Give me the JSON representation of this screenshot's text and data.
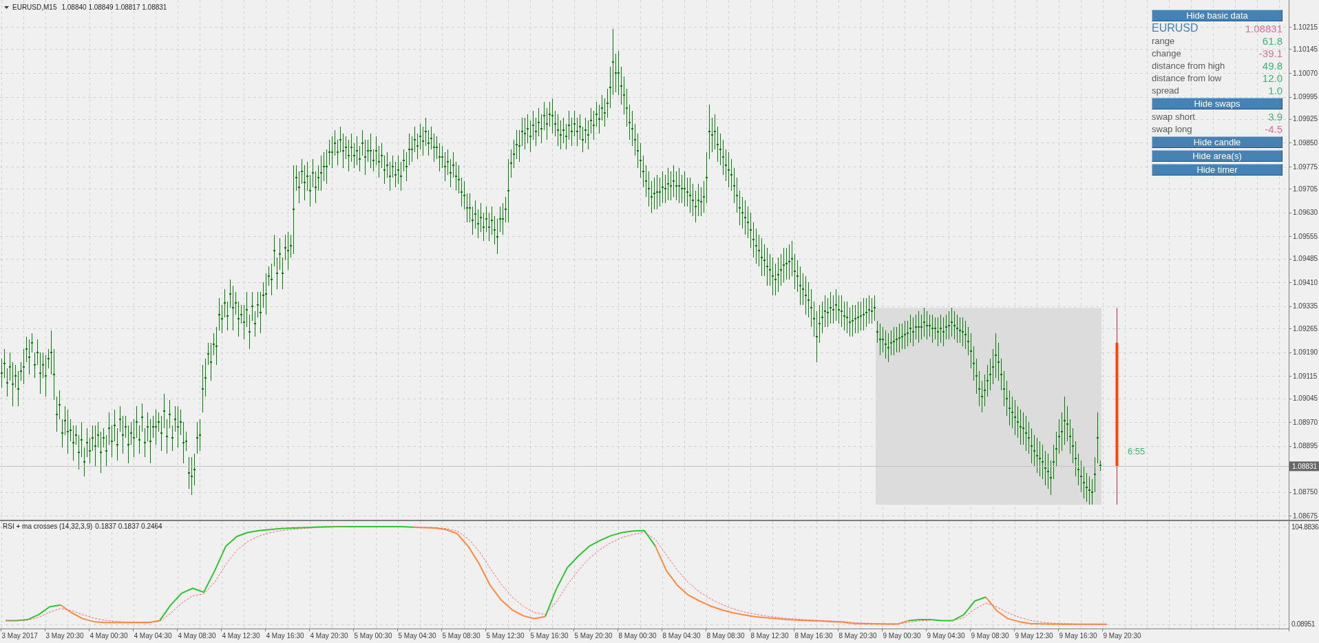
{
  "price_panel": {
    "header": {
      "symbol": "EURUSD,M15",
      "quotes": "1.08840 1.08849 1.08817 1.08831"
    },
    "chart_data": {
      "type": "scatter",
      "grid": true,
      "ylim": [
        1.08669,
        1.103
      ],
      "yticks": [
        {
          "value": 1.10215,
          "label": "1.10215"
        },
        {
          "value": 1.10145,
          "label": "1.10145"
        },
        {
          "value": 1.1007,
          "label": "1.10070"
        },
        {
          "value": 1.09995,
          "label": "1.09995"
        },
        {
          "value": 1.09925,
          "label": "1.09925"
        },
        {
          "value": 1.0985,
          "label": "1.09850"
        },
        {
          "value": 1.09775,
          "label": "1.09775"
        },
        {
          "value": 1.09705,
          "label": "1.09705"
        },
        {
          "value": 1.0963,
          "label": "1.09630"
        },
        {
          "value": 1.09555,
          "label": "1.09555"
        },
        {
          "value": 1.09485,
          "label": "1.09485"
        },
        {
          "value": 1.0941,
          "label": "1.09410"
        },
        {
          "value": 1.09335,
          "label": "1.09335"
        },
        {
          "value": 1.09265,
          "label": "1.09265"
        },
        {
          "value": 1.0919,
          "label": "1.09190"
        },
        {
          "value": 1.09115,
          "label": "1.09115"
        },
        {
          "value": 1.09045,
          "label": "1.09045"
        },
        {
          "value": 1.0897,
          "label": "1.08970"
        },
        {
          "value": 1.08895,
          "label": "1.08895"
        },
        {
          "value": 1.0875,
          "label": "1.08750"
        },
        {
          "value": 1.08675,
          "label": "1.08675"
        }
      ],
      "series": [
        {
          "color": "#007f00",
          "values": [
            1.09125,
            1.09155,
            1.09095,
            1.09145,
            1.0909,
            1.09115,
            1.09075,
            1.0913,
            1.09145,
            1.092,
            1.09175,
            1.0922,
            1.0915,
            1.0919,
            1.09125,
            1.0915,
            1.09115,
            1.0917,
            1.0919,
            1.0912,
            1.08995,
            1.09025,
            1.08935,
            1.08975,
            1.0894,
            1.08945,
            1.08905,
            1.0893,
            1.08875,
            1.08915,
            1.08845,
            1.08905,
            1.0888,
            1.0892,
            1.08895,
            1.0893,
            1.08875,
            1.0892,
            1.0888,
            1.0895,
            1.0891,
            1.0896,
            1.089,
            1.0898,
            1.0893,
            1.08955,
            1.089,
            1.08935,
            1.0892,
            1.0897,
            1.08915,
            1.08985,
            1.08905,
            1.08955,
            1.0891,
            1.08955,
            1.08955,
            1.0897,
            1.08935,
            1.09005,
            1.08925,
            1.08995,
            1.0892,
            1.0898,
            1.08955,
            1.0897,
            1.08905,
            1.0891,
            1.0881,
            1.088,
            1.0882,
            1.0892,
            1.0893,
            1.09075,
            1.0911,
            1.09185,
            1.0916,
            1.09215,
            1.0921,
            1.0931,
            1.09295,
            1.09345,
            1.09305,
            1.09375,
            1.0933,
            1.09345,
            1.09295,
            1.0931,
            1.09285,
            1.09325,
            1.09255,
            1.09335,
            1.0928,
            1.0934,
            1.09315,
            1.0937,
            1.09375,
            1.0943,
            1.0942,
            1.0951,
            1.0944,
            1.095,
            1.0944,
            1.0952,
            1.0951,
            1.09525,
            1.0964,
            1.0974,
            1.0971,
            1.0976,
            1.09725,
            1.09745,
            1.097,
            1.09755,
            1.0971,
            1.0974,
            1.09755,
            1.09775,
            1.09775,
            1.0982,
            1.0982,
            1.0985,
            1.0982,
            1.0986,
            1.09825,
            1.09835,
            1.0981,
            1.09835,
            1.0981,
            1.09825,
            1.098,
            1.0985,
            1.09805,
            1.09825,
            1.09825,
            1.09795,
            1.09825,
            1.0979,
            1.0981,
            1.09765,
            1.0978,
            1.09745,
            1.09775,
            1.0975,
            1.09765,
            1.09745,
            1.09795,
            1.09775,
            1.0983,
            1.0983,
            1.0986,
            1.0984,
            1.0987,
            1.09855,
            1.09885,
            1.0985,
            1.09865,
            1.09835,
            1.09835,
            1.09805,
            1.09805,
            1.09775,
            1.0979,
            1.09755,
            1.0978,
            1.09745,
            1.09735,
            1.09695,
            1.09685,
            1.09645,
            1.09645,
            1.09605,
            1.09625,
            1.09595,
            1.09615,
            1.09585,
            1.0961,
            1.09585,
            1.09605,
            1.09575,
            1.09555,
            1.0961,
            1.0961,
            1.0964,
            1.097,
            1.09785,
            1.09815,
            1.09845,
            1.0984,
            1.09885,
            1.0988,
            1.09895,
            1.0987,
            1.09905,
            1.09885,
            1.09915,
            1.09895,
            1.09935,
            1.0991,
            1.0994,
            1.09935,
            1.0991,
            1.0989,
            1.09875,
            1.0989,
            1.0987,
            1.09905,
            1.09885,
            1.0991,
            1.09885,
            1.099,
            1.0986,
            1.0989,
            1.09875,
            1.0992,
            1.09905,
            1.0994,
            1.09925,
            1.0996,
            1.09945,
            1.09975,
            1.10025,
            1.10105,
            1.1007,
            1.1007,
            1.1003,
            1.1,
            1.0996,
            1.09915,
            1.09895,
            1.0986,
            1.09825,
            1.09795,
            1.0976,
            1.0973,
            1.09705,
            1.0968,
            1.0969,
            1.09695,
            1.09695,
            1.0971,
            1.09705,
            1.0972,
            1.09715,
            1.0973,
            1.09715,
            1.09715,
            1.09705,
            1.09705,
            1.09695,
            1.09685,
            1.0967,
            1.0965,
            1.0967,
            1.09665,
            1.0968,
            1.0974,
            1.09885,
            1.09875,
            1.09885,
            1.09845,
            1.0983,
            1.09805,
            1.0978,
            1.09765,
            1.0975,
            1.09715,
            1.09685,
            1.09645,
            1.0963,
            1.09615,
            1.096,
            1.09575,
            1.09545,
            1.09525,
            1.0951,
            1.0949,
            1.0948,
            1.0946,
            1.0945,
            1.0943,
            1.0942,
            1.09435,
            1.0945,
            1.09465,
            1.0947,
            1.09475,
            1.09485,
            1.09445,
            1.0943,
            1.094,
            1.0939,
            1.0937,
            1.09355,
            1.0933,
            1.09295,
            1.0924,
            1.0928,
            1.093,
            1.0932,
            1.09315,
            1.0933,
            1.09325,
            1.0934,
            1.09325,
            1.0932,
            1.09305,
            1.093,
            1.09285,
            1.0929,
            1.09295,
            1.093,
            1.09305,
            1.0931,
            1.09315,
            1.09325,
            1.0932,
            1.0933,
            1.09255,
            1.0923,
            1.0923,
            1.09215,
            1.09205,
            1.0922,
            1.09225,
            1.0923,
            1.09235,
            1.0924,
            1.09245,
            1.0925,
            1.09265,
            1.09255,
            1.0927,
            1.0927,
            1.0927,
            1.09285,
            1.09275,
            1.09275,
            1.09265,
            1.09265,
            1.09255,
            1.09265,
            1.09255,
            1.0927,
            1.09275,
            1.09285,
            1.09275,
            1.09265,
            1.0926,
            1.09255,
            1.09245,
            1.09225,
            1.09195,
            1.09155,
            1.09115,
            1.09075,
            1.0905,
            1.0907,
            1.091,
            1.0912,
            1.09145,
            1.0918,
            1.0916,
            1.0912,
            1.09075,
            1.09045,
            1.09015,
            1.09,
            1.08985,
            1.0897,
            1.08955,
            1.0895,
            1.08935,
            1.0892,
            1.08895,
            1.0888,
            1.08865,
            1.08855,
            1.08845,
            1.08825,
            1.08815,
            1.08795,
            1.08845,
            1.08885,
            1.08925,
            1.0894,
            1.08975,
            1.08965,
            1.08925,
            1.08895,
            1.08855,
            1.0882,
            1.088,
            1.0878,
            1.08765,
            1.08755,
            1.0875,
            1.08805,
            1.0892,
            1.08833,
            null,
            null,
            null,
            null,
            null,
            null,
            null,
            null,
            null,
            null,
            null,
            null,
            null,
            null,
            null,
            null,
            null,
            null,
            null,
            null,
            null,
            null,
            null,
            null,
            null,
            null,
            null,
            null,
            null,
            null,
            null,
            null,
            null,
            null,
            null,
            null,
            null,
            null,
            null,
            null,
            null,
            null,
            null,
            null,
            null,
            null,
            null,
            null,
            null,
            null,
            null,
            null,
            null,
            null,
            null,
            null,
            null,
            null,
            null,
            null,
            null,
            null,
            null,
            null,
            null,
            null,
            null,
            null
          ],
          "errors": [
            0.00045,
            0.00045,
            0.00045,
            0.00045,
            0.0007,
            0.00035,
            0.00055,
            0.0003,
            0.00055,
            0.0004,
            0.00055,
            0.0003,
            0.0004,
            0.0004,
            0.00065,
            0.0004,
            0.00065,
            0.0003,
            0.0007,
            0.0008,
            0.00055,
            0.00045,
            0.00045,
            0.00045,
            0.0007,
            0.00035,
            0.00055,
            0.0003,
            0.00055,
            0.00055,
            0.00045,
            0.00045,
            0.0004,
            0.0004,
            0.00065,
            0.0004,
            0.00065,
            0.0003,
            0.0005,
            0.0005,
            0.0005,
            0.0005,
            0.0005,
            0.0004,
            0.0006,
            0.00035,
            0.0006,
            0.00035,
            0.0006,
            0.0005,
            0.00045,
            0.00045,
            0.00045,
            0.00045,
            0.0007,
            0.00035,
            0.00055,
            0.0003,
            0.00055,
            0.00055,
            0.00055,
            0.00045,
            0.0004,
            0.0004,
            0.00065,
            0.0004,
            0.00065,
            0.0003,
            0.0005,
            0.0006,
            0.0005,
            0.0005,
            0.0005,
            0.00075,
            0.0006,
            0.00035,
            0.0006,
            0.00035,
            0.0006,
            0.0005,
            0.00045,
            0.00045,
            0.00045,
            0.00045,
            0.0007,
            0.00035,
            0.00055,
            0.0003,
            0.00055,
            0.00055,
            0.00055,
            0.00045,
            0.0004,
            0.0004,
            0.00065,
            0.0004,
            0.00065,
            0.0003,
            0.0005,
            0.0005,
            0.0005,
            0.0005,
            0.0005,
            0.0004,
            0.0006,
            0.00035,
            0.0014,
            0.0004,
            0.0005,
            0.0004,
            0.00055,
            0.00045,
            0.0005,
            0.00045,
            0.0005,
            0.0004,
            0.00055,
            0.00045,
            0.00055,
            0.0004,
            0.0005,
            0.0004,
            0.0004,
            0.0004,
            0.00055,
            0.00035,
            0.0005,
            0.00045,
            0.0004,
            0.00045,
            0.0004,
            0.0004,
            0.00055,
            0.00035,
            0.00055,
            0.00035,
            0.00045,
            0.0005,
            0.0004,
            0.00045,
            0.0004,
            0.00045,
            0.00035,
            0.0004,
            0.00045,
            0.00045,
            0.00035,
            0.00045,
            0.0005,
            0.0004,
            0.0004,
            0.0004,
            0.0004,
            0.00045,
            0.00045,
            0.0004,
            0.00035,
            0.00045,
            0.00035,
            0.00045,
            0.00035,
            0.00045,
            0.0004,
            0.00045,
            0.0004,
            0.00045,
            0.00045,
            0.00045,
            0.00045,
            0.00045,
            0.00045,
            0.00045,
            0.00045,
            0.00045,
            0.00045,
            0.00045,
            0.0004,
            0.00045,
            0.00045,
            0.00045,
            0.00055,
            0.0004,
            0.0005,
            0.0004,
            0.001,
            0.00045,
            0.00045,
            0.00045,
            0.0005,
            0.00045,
            0.0005,
            0.00045,
            0.0005,
            0.00045,
            0.00045,
            0.00045,
            0.00045,
            0.00045,
            0.0005,
            0.0004,
            0.00055,
            0.0004,
            0.0005,
            0.00045,
            0.0004,
            0.0004,
            0.00045,
            0.00045,
            0.0004,
            0.00045,
            0.0004,
            0.0004,
            0.0004,
            0.00045,
            0.0004,
            0.00045,
            0.0004,
            0.00045,
            0.0004,
            0.00045,
            0.00045,
            0.00065,
            0.00105,
            0.0006,
            0.0007,
            0.0006,
            0.0006,
            0.0006,
            0.00055,
            0.00055,
            0.0005,
            0.00055,
            0.00055,
            0.0005,
            0.0005,
            0.00055,
            0.0005,
            0.0005,
            0.00055,
            0.00045,
            0.0005,
            0.00045,
            0.0005,
            0.00045,
            0.0005,
            0.00045,
            0.00055,
            0.00045,
            0.00055,
            0.00045,
            0.00055,
            0.0005,
            0.0005,
            0.0005,
            0.00045,
            0.0005,
            0.0008,
            0.00085,
            0.00055,
            0.00055,
            0.00055,
            0.0005,
            0.00055,
            0.0005,
            0.00055,
            0.0005,
            0.00055,
            0.00055,
            0.00055,
            0.0005,
            0.00055,
            0.0005,
            0.00055,
            0.00055,
            0.00055,
            0.0005,
            0.0006,
            0.0005,
            0.0006,
            0.0005,
            0.0006,
            0.0005,
            0.00055,
            0.0005,
            0.00055,
            0.0005,
            0.00055,
            0.00055,
            0.00055,
            0.0005,
            0.0006,
            0.0005,
            0.0006,
            0.00055,
            0.0006,
            0.00055,
            0.0008,
            0.0006,
            0.0005,
            0.0005,
            0.00045,
            0.0005,
            0.00045,
            0.0005,
            0.00045,
            0.0005,
            0.00045,
            0.0005,
            0.00045,
            0.0005,
            0.00045,
            0.0005,
            0.00045,
            0.0005,
            0.00045,
            0.00045,
            0.0004,
            0.0004,
            0.00035,
            0.0005,
            0.0004,
            0.00045,
            0.00045,
            0.0004,
            0.00045,
            0.0004,
            0.00045,
            0.0004,
            0.00045,
            0.0004,
            0.00045,
            0.00045,
            0.0004,
            0.0005,
            0.0004,
            0.00045,
            0.00045,
            0.00035,
            0.00045,
            0.00035,
            0.00045,
            0.00045,
            0.00045,
            0.0004,
            0.00045,
            0.00045,
            0.00045,
            0.00045,
            0.0004,
            0.00045,
            0.00045,
            0.00045,
            0.00055,
            0.00055,
            0.00055,
            0.00055,
            0.0005,
            0.0005,
            0.0005,
            0.0005,
            0.00055,
            0.0007,
            0.0006,
            0.0005,
            0.00055,
            0.00055,
            0.00055,
            0.0005,
            0.00055,
            0.0005,
            0.00055,
            0.0005,
            0.00055,
            0.0005,
            0.00055,
            0.0005,
            0.00055,
            0.00055,
            0.00055,
            0.00055,
            0.00055,
            0.00055,
            0.00055,
            0.00055,
            0.00055,
            0.0006,
            0.00075,
            0.00055,
            0.00055,
            0.00055,
            0.00055,
            0.0005,
            0.0005,
            0.0005,
            0.00045,
            0.00045,
            0.0004,
            0.00055,
            0.0008,
            0.00016,
            null,
            null,
            null,
            null,
            null,
            null,
            null,
            null,
            null,
            null,
            null,
            null,
            null,
            null,
            null,
            null,
            null,
            null,
            null,
            null,
            null,
            null,
            null,
            null,
            null,
            null,
            null,
            null,
            null,
            null,
            null,
            null,
            null,
            null,
            null,
            null,
            null,
            null,
            null,
            null,
            null,
            null,
            null,
            null,
            null,
            null,
            null,
            null,
            null,
            null,
            null,
            null,
            null,
            null,
            null,
            null,
            null,
            null,
            null,
            null,
            null,
            null,
            null,
            null,
            null,
            null,
            null,
            null
          ]
        }
      ],
      "ref_lines": [
        {
          "axis": "y",
          "value": 1.08831,
          "label": "1.08831"
        }
      ],
      "annotations": [
        "6:55"
      ]
    }
  },
  "info_panel": {
    "items": [
      {
        "kind": "button",
        "label": "Hide basic data"
      },
      {
        "kind": "symbol",
        "label": "EURUSD",
        "value": "1.08831",
        "color": "#db7093"
      },
      {
        "kind": "row",
        "label": "range",
        "value": "61.8",
        "color": "#3cb371"
      },
      {
        "kind": "row",
        "label": "change",
        "value": "-39.1",
        "color": "#db7093"
      },
      {
        "kind": "row",
        "label": "distance from high",
        "value": "49.8",
        "color": "#3cb371"
      },
      {
        "kind": "row",
        "label": "distance from low",
        "value": "12.0",
        "color": "#3cb371"
      },
      {
        "kind": "row",
        "label": "spread",
        "value": "1.0",
        "color": "#3cb371"
      },
      {
        "kind": "button",
        "label": "Hide swaps"
      },
      {
        "kind": "row",
        "label": "swap short",
        "value": "3.9",
        "color": "#3cb371"
      },
      {
        "kind": "row",
        "label": "swap long",
        "value": "-4.5",
        "color": "#db7093"
      },
      {
        "kind": "button",
        "label": "Hide candle"
      },
      {
        "kind": "button",
        "label": "Hide area(s)"
      },
      {
        "kind": "button",
        "label": "Hide timer"
      }
    ]
  },
  "indicator_panel": {
    "header": {
      "name": "RSI + ma crosses (14,32,3,9)",
      "values": "0.1837 0.1837 0.2464"
    },
    "chart_data": {
      "type": "line",
      "grid": true,
      "ylim": [
        -4.34,
        110.79
      ],
      "categories": [
        null,
        "3 May 2017",
        null,
        null,
        null,
        "3 May 20:30",
        null,
        null,
        null,
        "4 May 00:30",
        null,
        null,
        null,
        "4 May 04:30",
        null,
        null,
        null,
        "4 May 08:30",
        null,
        null,
        null,
        "4 May 12:30",
        null,
        null,
        null,
        "4 May 16:30",
        null,
        null,
        null,
        "4 May 20:30",
        null,
        null,
        null,
        "5 May 00:30",
        null,
        null,
        null,
        "5 May 04:30",
        null,
        null,
        null,
        "5 May 08:30",
        null,
        null,
        null,
        "5 May 12:30",
        null,
        null,
        null,
        "5 May 16:30",
        null,
        null,
        null,
        "5 May 20:30",
        null,
        null,
        null,
        "8 May 00:30",
        null,
        null,
        null,
        "8 May 04:30",
        null,
        null,
        null,
        "8 May 08:30",
        null,
        null,
        null,
        "8 May 12:30",
        null,
        null,
        null,
        "8 May 16:30",
        null,
        null,
        null,
        "8 May 20:30",
        null,
        null,
        null,
        "9 May 00:30",
        null,
        null,
        null,
        "9 May 04:30",
        null,
        null,
        null,
        "9 May 08:30",
        null,
        null,
        null,
        "9 May 12:30",
        null,
        null,
        null,
        "9 May 16:30",
        null,
        null,
        null,
        "9 May 20:30",
        null,
        null,
        null,
        null,
        null,
        null,
        null,
        null,
        null,
        null,
        null,
        null,
        null,
        null,
        null
      ],
      "yticks": [
        {
          "value": 104.8836,
          "label": "104.8836"
        },
        {
          "value": 0.08951,
          "label": "0.08951"
        }
      ],
      "series": [
        {
          "color": "#2fc52f",
          "values": [
            4.2,
            4.2,
            5.2,
            10.5,
            18.9,
            21,
            null,
            null,
            null,
            null,
            null,
            null,
            null,
            null,
            4.2,
            21,
            33.6,
            38.8,
            34.6,
            57.7,
            83.9,
            94.4,
            98.6,
            100.7,
            101.7,
            102.8,
            103.3,
            103.8,
            104.4,
            104.7,
            104.9,
            104.9,
            104.9,
            104.9,
            104.9,
            104.9,
            104.9,
            104.4,
            null,
            null,
            null,
            null,
            null,
            null,
            null,
            null,
            null,
            null,
            null,
            8.4,
            37.8,
            60.8,
            73.4,
            83.9,
            90.2,
            95.4,
            98.6,
            100.2,
            100.7,
            83.9,
            null,
            null,
            null,
            null,
            null,
            null,
            null,
            null,
            null,
            null,
            null,
            null,
            null,
            null,
            null,
            null,
            null,
            null,
            null,
            null,
            null,
            null,
            4.2,
            5.2,
            5.2,
            4.2,
            4.2,
            10.5,
            25.2,
            29.4,
            null,
            null,
            null,
            null,
            null,
            null,
            null,
            null,
            null,
            null,
            null,
            null,
            null,
            null,
            null,
            null,
            null,
            null,
            null,
            null,
            null,
            null,
            null,
            null,
            null,
            null,
            null
          ]
        },
        {
          "color": "#ff8a3c",
          "values": [
            null,
            null,
            null,
            null,
            null,
            21,
            12.6,
            6.3,
            3.1,
            2.1,
            2.1,
            2.1,
            2.1,
            2.1,
            4.2,
            null,
            null,
            null,
            null,
            null,
            null,
            null,
            null,
            null,
            null,
            null,
            null,
            null,
            null,
            null,
            null,
            null,
            null,
            null,
            null,
            null,
            null,
            104.4,
            103.8,
            103.3,
            101.7,
            97.5,
            83.9,
            65,
            42,
            26.2,
            15.7,
            9.4,
            6.3,
            8.4,
            null,
            null,
            null,
            null,
            null,
            null,
            null,
            null,
            null,
            83.9,
            57.7,
            42,
            31.5,
            25.2,
            19.9,
            15.7,
            12.6,
            10.5,
            8.4,
            7.3,
            6.3,
            5.2,
            4.7,
            4.2,
            3.7,
            3.1,
            2.6,
            1,
            0.8,
            0.6,
            0.5,
            0.5,
            4.2,
            null,
            null,
            null,
            null,
            null,
            null,
            29.4,
            14.7,
            6.3,
            3.1,
            1,
            0.6,
            0.4,
            0.3,
            0.3,
            0.2,
            0.2,
            0.2,
            null,
            null,
            null,
            null,
            null,
            null,
            null,
            null,
            null,
            null,
            null,
            null,
            null,
            null,
            null,
            null
          ]
        },
        {
          "color": "#ff6a6a",
          "line_style": "dashed",
          "values": [
            4.2,
            4.2,
            4.7,
            7.7,
            13.2,
            17.1,
            14.9,
            10.6,
            6.8,
            4.5,
            3.3,
            2.7,
            2.4,
            2.2,
            3.3,
            12.1,
            22.9,
            30.8,
            32.7,
            45.2,
            64.5,
            79.5,
            89,
            94.8,
            98.3,
            100.6,
            101.9,
            102.9,
            103.6,
            104.1,
            104.6,
            104.7,
            null,
            null,
            null,
            null,
            null,
            104.6,
            104.2,
            103.7,
            102.8,
            100.2,
            92,
            78.6,
            60.2,
            43.2,
            29.5,
            19.5,
            12.9,
            10.6,
            24.1,
            42.5,
            58,
            70.9,
            80.5,
            88,
            93.3,
            96.7,
            98.7,
            91.2,
            74.5,
            58.2,
            44.9,
            35,
            27.5,
            21.6,
            17.1,
            13.7,
            11.1,
            9.2,
            7.8,
            6.5,
            5.6,
            4.9,
            4.3,
            3.7,
            3.1,
            2.1,
            1.5,
            1,
            0.8,
            0.6,
            2.4,
            3.9,
            4.5,
            null,
            4.3,
            7.3,
            16.3,
            22.9,
            18.8,
            12.6,
            7.9,
            4.5,
            2.5,
            1.5,
            0.9,
            0.6,
            0.4,
            0.3,
            0.3,
            null,
            null,
            null,
            null,
            null,
            null,
            null,
            null,
            null,
            null,
            null,
            null,
            null,
            null,
            null,
            null
          ]
        }
      ]
    }
  }
}
